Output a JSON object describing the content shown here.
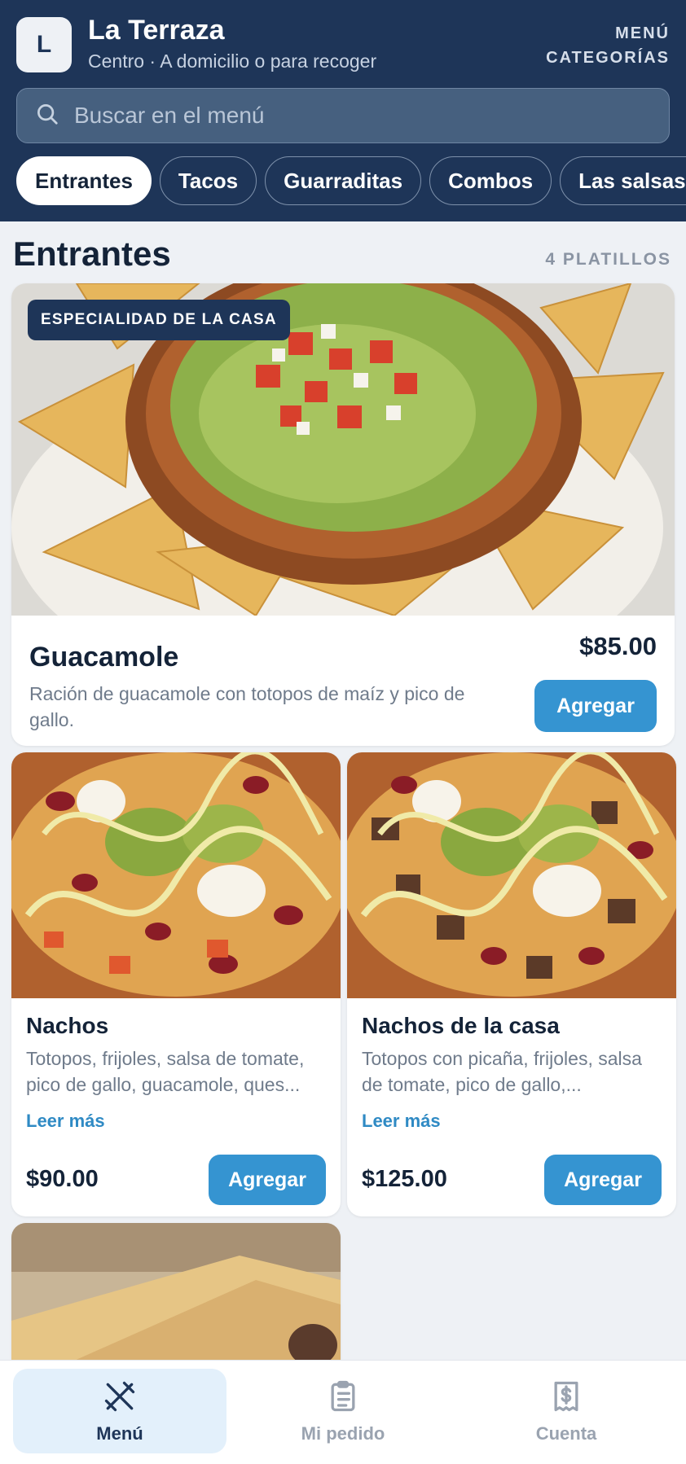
{
  "header": {
    "logo_letter": "L",
    "restaurant_name": "La Terraza",
    "subtitle": "Centro · A domicilio o para recoger",
    "menu_link_line1": "MENÚ",
    "menu_link_line2": "CATEGORÍAS",
    "search_placeholder": "Buscar en el menú"
  },
  "tabs": [
    {
      "label": "Entrantes",
      "active": true
    },
    {
      "label": "Tacos",
      "active": false
    },
    {
      "label": "Guarraditas",
      "active": false
    },
    {
      "label": "Combos",
      "active": false
    },
    {
      "label": "Las salsas A",
      "active": false
    }
  ],
  "section": {
    "title": "Entrantes",
    "count": "4 PLATILLOS"
  },
  "featured": {
    "badge": "ESPECIALIDAD DE LA CASA",
    "name": "Guacamole",
    "description": "Ración de guacamole con totopos de maíz y pico de gallo.",
    "price": "$85.00",
    "button": "Agregar"
  },
  "items": [
    {
      "name": "Nachos",
      "description": "Totopos, frijoles, salsa de tomate, pico de gallo, guacamole, ques...",
      "more": "Leer más",
      "price": "$90.00",
      "button": "Agregar"
    },
    {
      "name": "Nachos de la casa",
      "description": "Totopos con picaña, frijoles, salsa de tomate, pico de gallo,...",
      "more": "Leer más",
      "price": "$125.00",
      "button": "Agregar"
    }
  ],
  "bottom_nav": [
    {
      "label": "Menú",
      "icon": "utensils-icon",
      "active": true
    },
    {
      "label": "Mi pedido",
      "icon": "clipboard-icon",
      "active": false
    },
    {
      "label": "Cuenta",
      "icon": "receipt-dollar-icon",
      "active": false
    }
  ],
  "colors": {
    "header_bg": "#1e3558",
    "accent": "#3594d1",
    "page_bg": "#eef1f5"
  }
}
